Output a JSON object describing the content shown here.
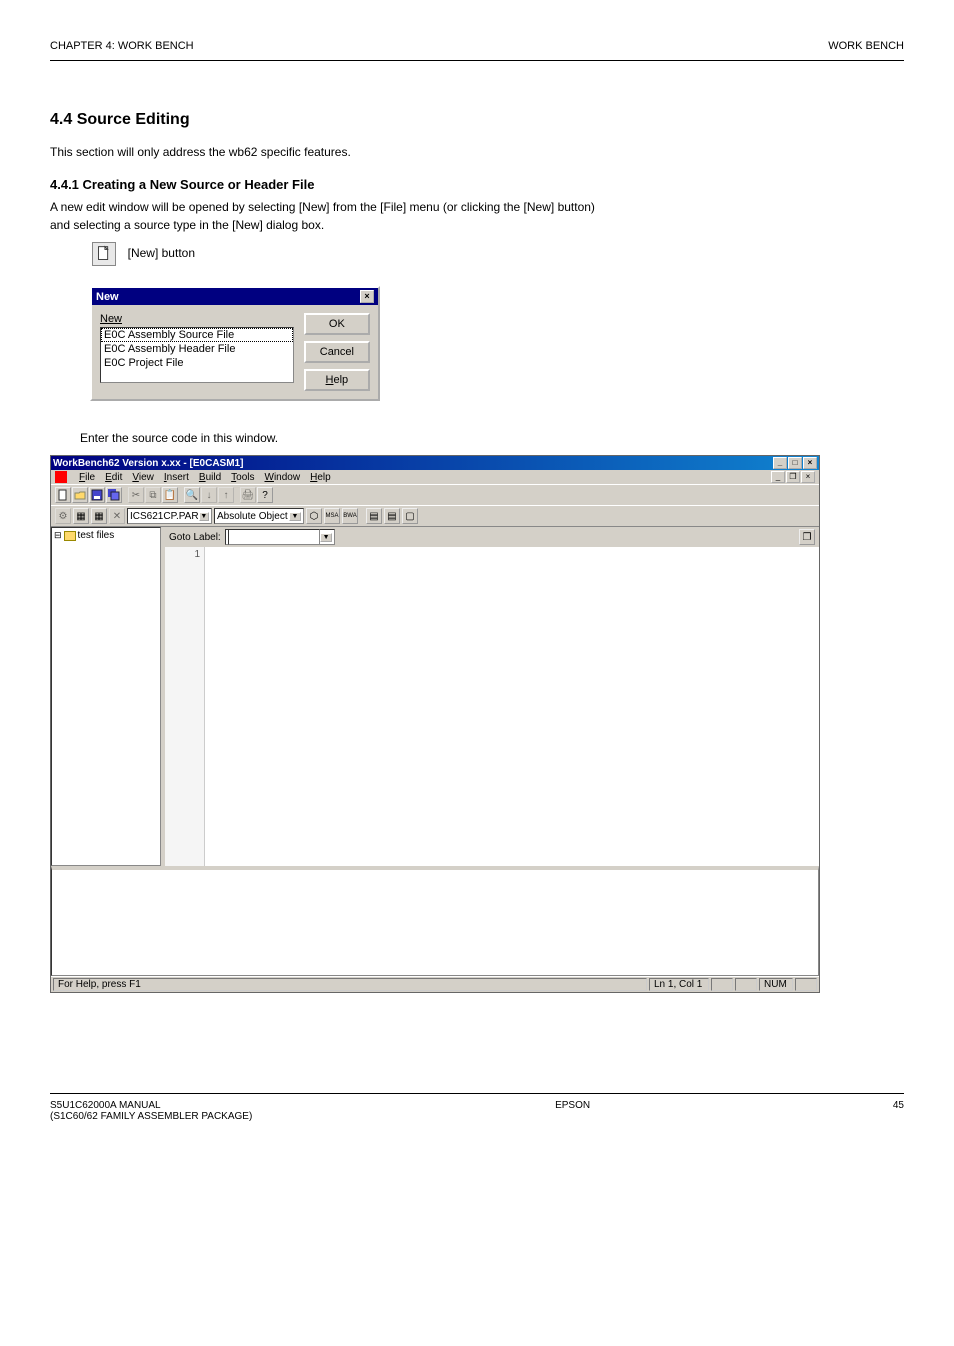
{
  "header": {
    "left": "CHAPTER 4: WORK BENCH",
    "right": "WORK BENCH"
  },
  "section": {
    "num_title": "4.4  Source Editing",
    "intro": "This section will only address the wb62 specific features.",
    "sub_num_title": "4.4.1  Creating a New Source or Header File",
    "body1": "A new edit window will be opened by selecting [New] from the [File] menu (or clicking the [New] button)",
    "body2": "and selecting a source type in the [New] dialog box."
  },
  "new_button_label": "[New] button",
  "new_dialog": {
    "title": "New",
    "label": "New",
    "items": [
      "E0C Assembly Source File",
      "E0C Assembly Header File",
      "E0C Project File"
    ],
    "ok": "OK",
    "cancel": "Cancel",
    "help": "Help"
  },
  "post_text": "Enter the source code in this window.",
  "app": {
    "title": "WorkBench62  Version x.xx - [E0CASM1]",
    "menus": [
      "File",
      "Edit",
      "View",
      "Insert",
      "Build",
      "Tools",
      "Window",
      "Help"
    ],
    "select1": "ICS621CP.PAR",
    "select2": "Absolute Object",
    "goto_label": "Goto Label:",
    "tree_root": "test files",
    "gutter_line": "1",
    "status_left": "For Help, press F1",
    "status_lncol": "Ln 1, Col 1",
    "status_num": "NUM"
  },
  "footer": {
    "left": "S5U1C62000A MANUAL",
    "right": "EPSON",
    "page": "45",
    "sub": "(S1C60/62 FAMILY ASSEMBLER PACKAGE)"
  }
}
